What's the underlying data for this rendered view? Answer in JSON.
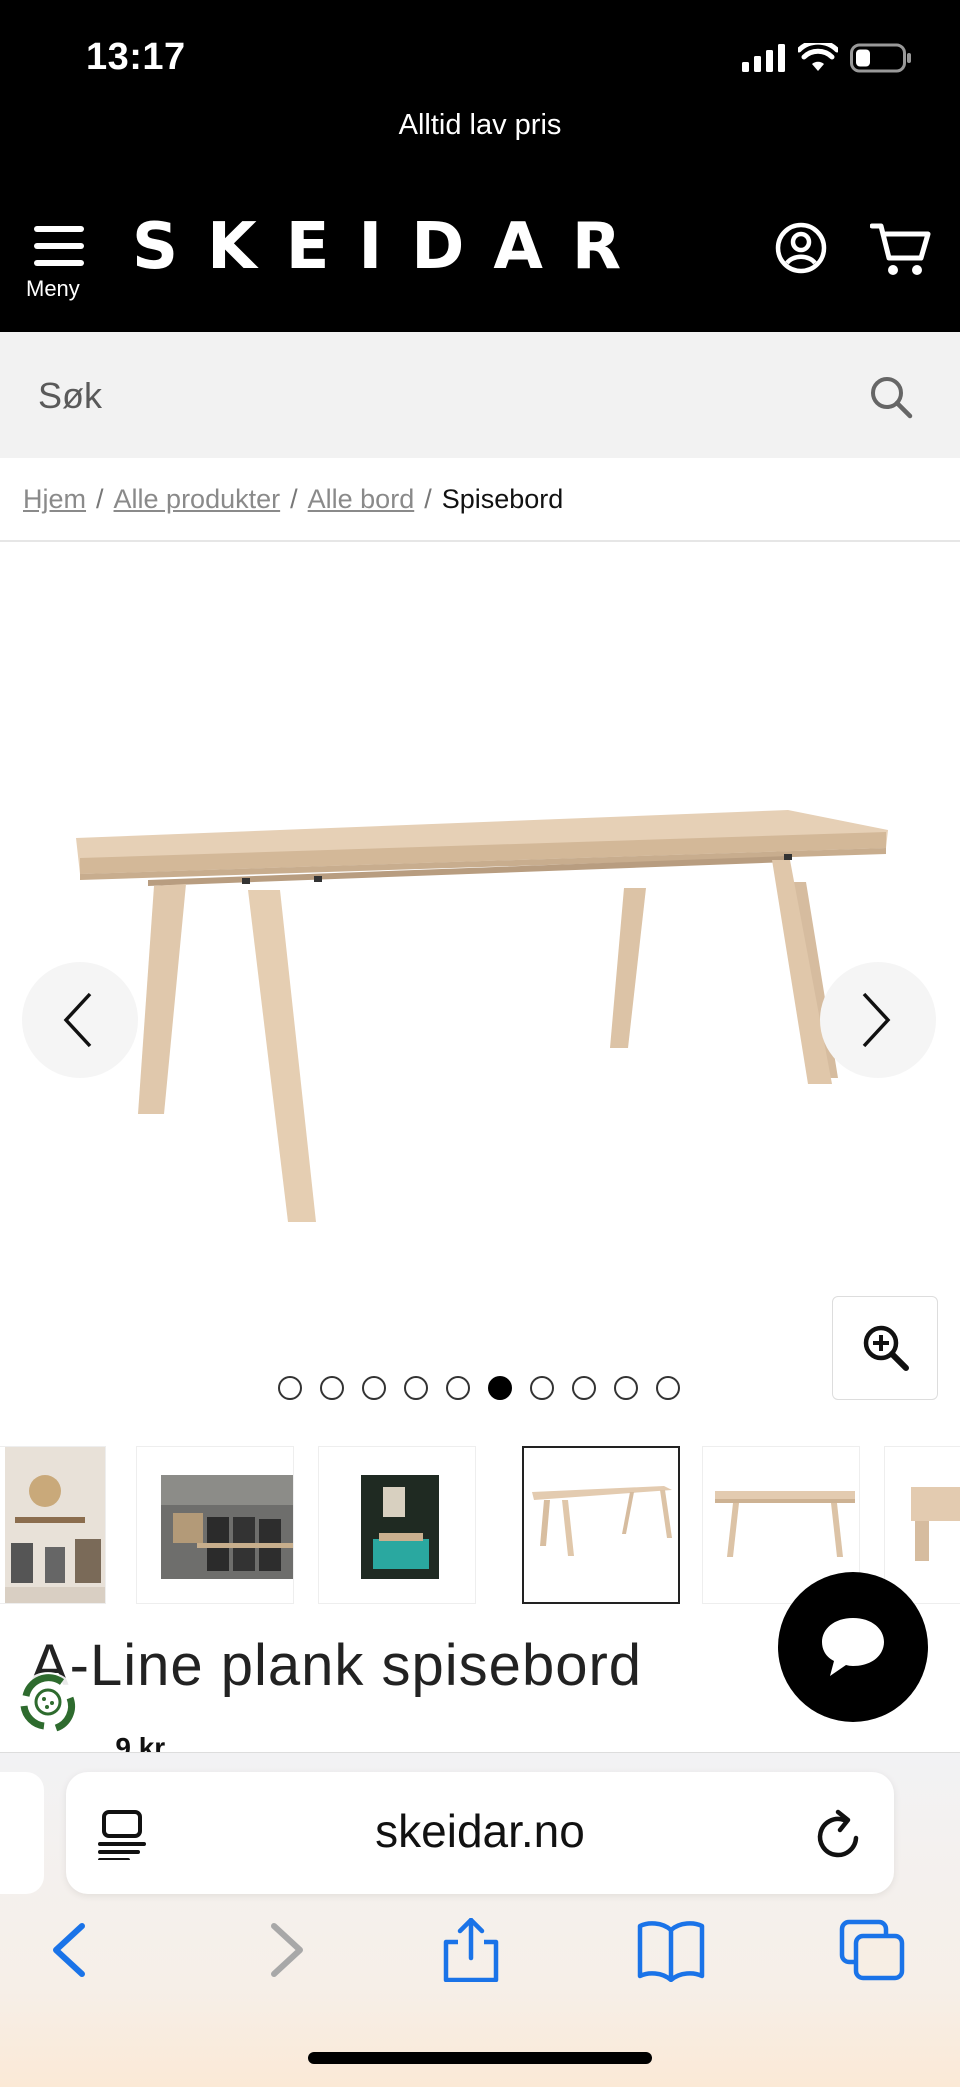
{
  "status_bar": {
    "time": "13:17"
  },
  "promo": {
    "text": "Alltid lav pris"
  },
  "header": {
    "menu_label": "Meny",
    "logo": "SKEIDAR"
  },
  "search": {
    "placeholder": "Søk"
  },
  "breadcrumb": {
    "items": [
      "Hjem",
      "Alle produkter",
      "Alle bord"
    ],
    "current": "Spisebord",
    "separator": "/"
  },
  "gallery": {
    "total_images": 10,
    "active_index": 5
  },
  "product": {
    "title": "A-Line plank spisebord",
    "price_partial": "...9 kr"
  },
  "browser": {
    "url": "skeidar.no"
  },
  "colors": {
    "header_bg": "#000000",
    "search_bg": "#f2f2f2",
    "safari_blue": "#1a73e8",
    "eco_green": "#2e6b2e",
    "wood": "#e3cbb0"
  }
}
